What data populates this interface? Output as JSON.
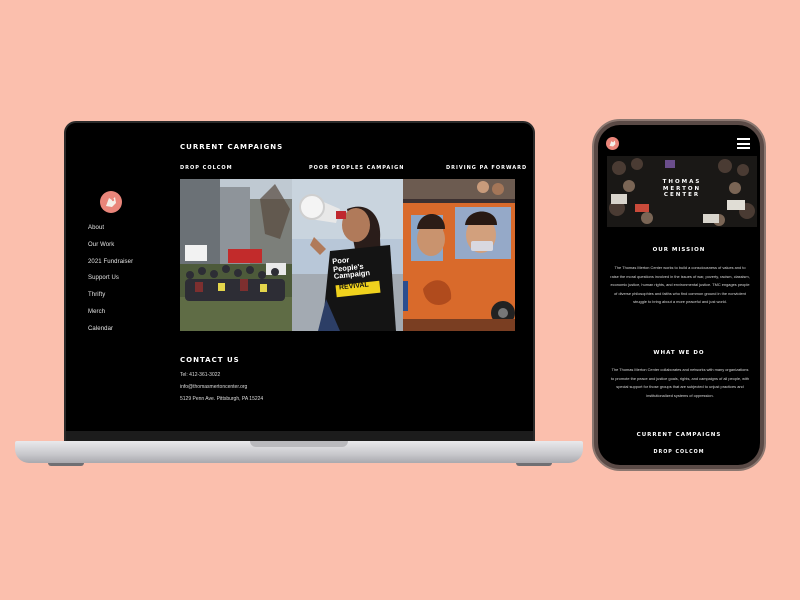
{
  "laptop": {
    "nav": [
      "About",
      "Our Work",
      "2021 Fundraiser",
      "Support Us",
      "Thrifty",
      "Merch",
      "Calendar"
    ],
    "campaigns": {
      "title": "CURRENT CAMPAIGNS",
      "items": [
        "DROP COLCOM",
        "POOR PEOPLES CAMPAIGN",
        "DRIVING PA FORWARD"
      ]
    },
    "contact": {
      "title": "CONTACT US",
      "phone": "Tel: 412-361-3022",
      "email": "info@thomasmertoncenter.org",
      "address": "5129 Penn Ave. Pittsburgh, PA 15224"
    },
    "photo_signs": {
      "sign_line1": "Poor",
      "sign_line2": "People's",
      "sign_line3": "Campaign",
      "shirt": "REVIVAL"
    }
  },
  "phone": {
    "hero_text": [
      "THOMAS",
      "MERTON",
      "CENTER"
    ],
    "mission_title": "OUR MISSION",
    "mission_text": "The Thomas Merton Center works to build a consciousness of values and to raise the moral questions involved in the issues of war, poverty, racism, classism, economic justice, human rights, and environmental justice. TMC engages people of diverse philosophies and faiths who find common ground in the nonviolent struggle to bring about a more peaceful and just world.",
    "whatwedo_title": "WHAT WE DO",
    "whatwedo_text": "The Thomas Merton Center collaborates and networks with many organizations to promote the peace and justice goals, rights, and campaigns of all people, with special support for those groups that are subjected to unjust practices and institutionalized systems of oppression.",
    "campaigns_title": "CURRENT CAMPAIGNS",
    "first_campaign": "DROP COLCOM"
  },
  "colors": {
    "background": "#fbbfad",
    "logo": "#e9857a",
    "screen": "#000000"
  }
}
